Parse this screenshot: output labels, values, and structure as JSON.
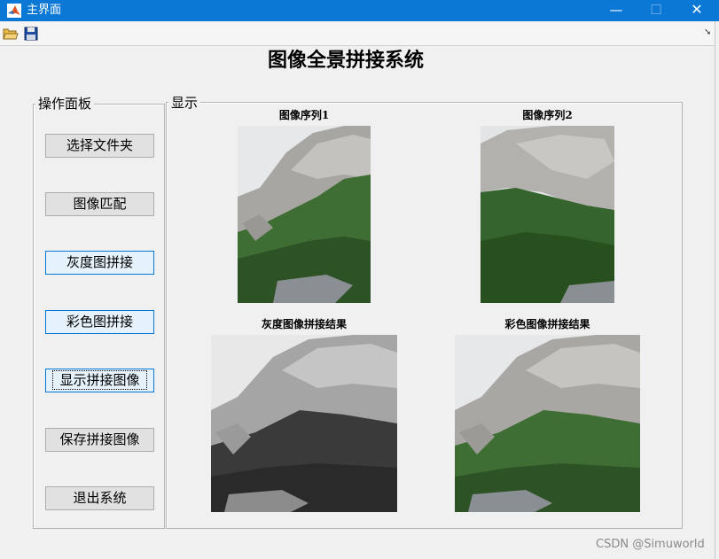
{
  "window": {
    "title": "主界面"
  },
  "main_title": "图像全景拼接系统",
  "control_panel": {
    "label": "操作面板",
    "buttons": [
      "选择文件夹",
      "图像匹配",
      "灰度图拼接",
      "彩色图拼接",
      "显示拼接图像",
      "保存拼接图像",
      "退出系统"
    ]
  },
  "display_panel": {
    "label": "显示",
    "images": [
      "图像序列1",
      "图像序列2",
      "灰度图像拼接结果",
      "彩色图像拼接结果"
    ]
  },
  "watermark": "CSDN @Simuworld",
  "icons": [
    "matlab-icon",
    "open-folder-icon",
    "save-icon",
    "minimize-icon",
    "maximize-icon",
    "close-icon",
    "toolbar-arrow-icon"
  ],
  "colors": {
    "titlebar": "#0a78d4",
    "background": "#f0f0f0",
    "button_focus": "#0078d7"
  }
}
